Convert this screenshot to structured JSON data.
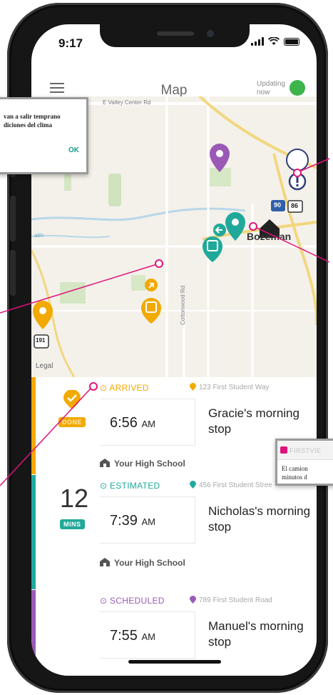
{
  "status_bar": {
    "time": "9:17"
  },
  "header": {
    "title": "Map",
    "updating_line1": "Updating",
    "updating_line2": "now"
  },
  "map": {
    "road_label": "E Valley Center Rd",
    "road_label_2": "Cottonwood Rd",
    "city_label": "Bozeman",
    "highway_90": "90",
    "highway_86": "86",
    "highway_191": "191",
    "legal": "Legal",
    "area_label": "atin"
  },
  "trips": [
    {
      "status": "ARRIVED",
      "address": "123 First Student Way",
      "time": "6:56",
      "ampm": "AM",
      "stop": "Gracie's morning stop",
      "school": "Your High School",
      "badge": "DONE",
      "color": "#f2a900"
    },
    {
      "status": "ESTIMATED",
      "address": "456 First Student Stree",
      "time": "7:39",
      "ampm": "AM",
      "stop": "Nicholas's morning stop",
      "school": "Your High School",
      "eta_number": "12",
      "badge": "MINS",
      "color": "#20a99a"
    },
    {
      "status": "SCHEDULED",
      "address": "789 First Student Road",
      "time": "7:55",
      "ampm": "AM",
      "stop": "Manuel's morning stop",
      "color": "#9b59b6"
    }
  ],
  "popup_left": {
    "line1": "van a salir temprano",
    "line2": "diciones del clima",
    "ok": "OK"
  },
  "popup_right": {
    "header": "FIRSTVIE",
    "line1": "El camion",
    "line2": "minutos d"
  },
  "colors": {
    "live": "#3cb44a",
    "callout": "#e0137a",
    "teal": "#20a99a",
    "amber": "#f2a900",
    "purple": "#9b59b6"
  }
}
